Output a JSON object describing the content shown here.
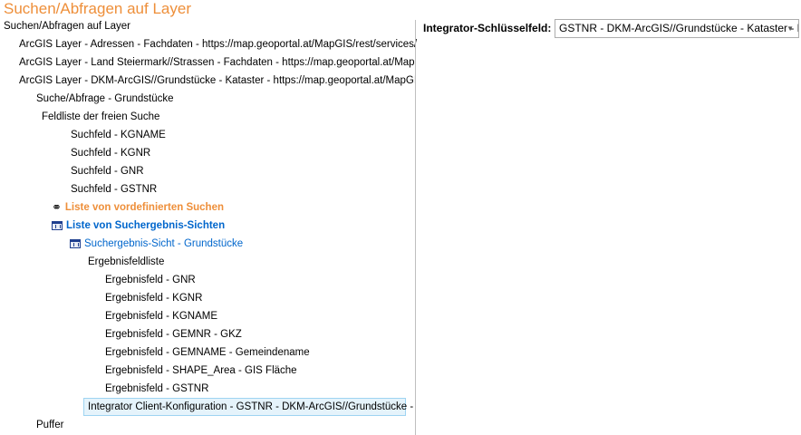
{
  "title": "Suchen/Abfragen auf Layer",
  "tree": [
    {
      "label": "Suchen/Abfragen auf Layer"
    },
    {
      "label": "ArcGIS Layer - Adressen - Fachdaten - https://map.geoportal.at/MapGIS/rest/services/"
    },
    {
      "label": "ArcGIS Layer - Land Steiermark//Strassen - Fachdaten - https://map.geoportal.at/Map"
    },
    {
      "label": "ArcGIS Layer - DKM-ArcGIS//Grundstücke - Kataster - https://map.geoportal.at/MapGI"
    },
    {
      "label": "Suche/Abfrage - Grundstücke"
    },
    {
      "label": "Feldliste der freien Suche"
    },
    {
      "label": "Suchfeld - KGNAME"
    },
    {
      "label": "Suchfeld - KGNR"
    },
    {
      "label": "Suchfeld - GNR"
    },
    {
      "label": "Suchfeld - GSTNR"
    },
    {
      "label": "Liste von vordefinierten Suchen",
      "icon": "binoculars-icon"
    },
    {
      "label": "Liste von Suchergebnis-Sichten",
      "icon": "table-icon"
    },
    {
      "label": "Suchergebnis-Sicht - Grundstücke",
      "icon": "table-icon"
    },
    {
      "label": "Ergebnisfeldliste"
    },
    {
      "label": "Ergebnisfeld - GNR"
    },
    {
      "label": "Ergebnisfeld - KGNR"
    },
    {
      "label": "Ergebnisfeld - KGNAME"
    },
    {
      "label": "Ergebnisfeld - GEMNR - GKZ"
    },
    {
      "label": "Ergebnisfeld - GEMNAME - Gemeindename"
    },
    {
      "label": "Ergebnisfeld - SHAPE_Area - GIS Fläche"
    },
    {
      "label": "Ergebnisfeld - GSTNR"
    },
    {
      "label": "Integrator Client-Konfiguration - GSTNR - DKM-ArcGIS//Grundstücke -",
      "selected": true
    },
    {
      "label": "Puffer"
    }
  ],
  "details": {
    "key_label": "Integrator-Schlüsselfeld:",
    "key_value": "GSTNR - DKM-ArcGIS//Grundstücke - Kataster - h"
  },
  "colors": {
    "accent": "#ee8f3a",
    "link": "#0066cc",
    "selection": "#e5f3fb"
  }
}
